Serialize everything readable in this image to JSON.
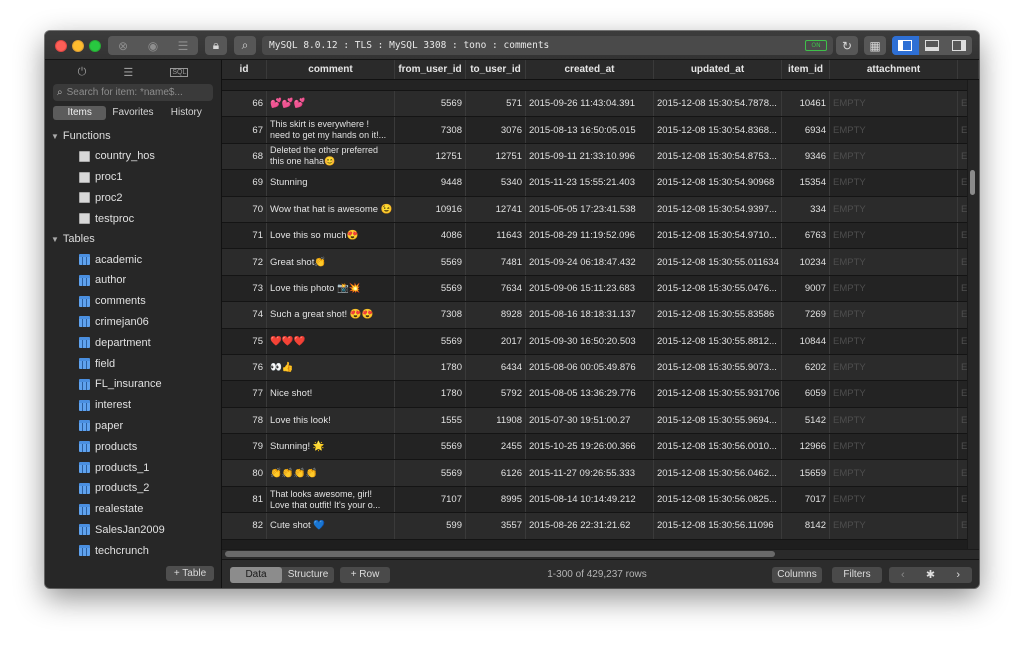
{
  "titlebar": {
    "connection": "MySQL 8.0.12 : TLS : MySQL 3308 : tono : comments",
    "connection_badge": "ON",
    "icons": [
      "close-tab-icon",
      "eye-icon",
      "list-icon",
      "lock-icon",
      "search-icon",
      "refresh-icon",
      "grid-icon",
      "left-panel-icon",
      "bottom-panel-icon",
      "right-panel-icon"
    ]
  },
  "sidebar": {
    "search_placeholder": "Search for item: *name$...",
    "tabs": [
      "Items",
      "Favorites",
      "History"
    ],
    "active_tab": "Items",
    "functions_label": "Functions",
    "functions": [
      "country_hos",
      "proc1",
      "proc2",
      "testproc"
    ],
    "tables_label": "Tables",
    "tables": [
      "academic",
      "author",
      "comments",
      "crimejan06",
      "department",
      "field",
      "FL_insurance",
      "interest",
      "paper",
      "products",
      "products_1",
      "products_2",
      "realestate",
      "SalesJan2009",
      "techcrunch"
    ],
    "add_table_label": "+ Table"
  },
  "grid": {
    "columns": [
      "id",
      "comment",
      "from_user_id",
      "to_user_id",
      "created_at",
      "updated_at",
      "item_id",
      "attachment"
    ],
    "rows": [
      {
        "id": "66",
        "comment": "💕💕💕",
        "from": "5569",
        "to": "571",
        "created": "2015-09-26 11:43:04.391",
        "updated": "2015-12-08 15:30:54.7878...",
        "item": "10461",
        "attach": "EMPTY"
      },
      {
        "id": "67",
        "comment": "This skirt is everywhere ! need to get my hands on it!...",
        "from": "7308",
        "to": "3076",
        "created": "2015-08-13 16:50:05.015",
        "updated": "2015-12-08 15:30:54.8368...",
        "item": "6934",
        "attach": "EMPTY"
      },
      {
        "id": "68",
        "comment": "Deleted the other preferred this one haha😊",
        "from": "12751",
        "to": "12751",
        "created": "2015-09-11 21:33:10.996",
        "updated": "2015-12-08 15:30:54.8753...",
        "item": "9346",
        "attach": "EMPTY"
      },
      {
        "id": "69",
        "comment": "Stunning",
        "from": "9448",
        "to": "5340",
        "created": "2015-11-23 15:55:21.403",
        "updated": "2015-12-08 15:30:54.90968",
        "item": "15354",
        "attach": "EMPTY"
      },
      {
        "id": "70",
        "comment": "Wow that hat is awesome 😉",
        "from": "10916",
        "to": "12741",
        "created": "2015-05-05 17:23:41.538",
        "updated": "2015-12-08 15:30:54.9397...",
        "item": "334",
        "attach": "EMPTY"
      },
      {
        "id": "71",
        "comment": " Love this so much😍",
        "from": "4086",
        "to": "11643",
        "created": "2015-08-29 11:19:52.096",
        "updated": "2015-12-08 15:30:54.9710...",
        "item": "6763",
        "attach": "EMPTY"
      },
      {
        "id": "72",
        "comment": "Great shot👏",
        "from": "5569",
        "to": "7481",
        "created": "2015-09-24 06:18:47.432",
        "updated": "2015-12-08 15:30:55.011634",
        "item": "10234",
        "attach": "EMPTY"
      },
      {
        "id": "73",
        "comment": "Love this photo 📸💥",
        "from": "5569",
        "to": "7634",
        "created": "2015-09-06 15:11:23.683",
        "updated": "2015-12-08 15:30:55.0476...",
        "item": "9007",
        "attach": "EMPTY"
      },
      {
        "id": "74",
        "comment": "Such a great shot! 😍😍",
        "from": "7308",
        "to": "8928",
        "created": "2015-08-16 18:18:31.137",
        "updated": "2015-12-08 15:30:55.83586",
        "item": "7269",
        "attach": "EMPTY"
      },
      {
        "id": "75",
        "comment": "❤️❤️❤️",
        "from": "5569",
        "to": "2017",
        "created": "2015-09-30 16:50:20.503",
        "updated": "2015-12-08 15:30:55.8812...",
        "item": "10844",
        "attach": "EMPTY"
      },
      {
        "id": "76",
        "comment": "👀👍",
        "from": "1780",
        "to": "6434",
        "created": "2015-08-06 00:05:49.876",
        "updated": "2015-12-08 15:30:55.9073...",
        "item": "6202",
        "attach": "EMPTY"
      },
      {
        "id": "77",
        "comment": "Nice shot!",
        "from": "1780",
        "to": "5792",
        "created": "2015-08-05 13:36:29.776",
        "updated": "2015-12-08 15:30:55.931706",
        "item": "6059",
        "attach": "EMPTY"
      },
      {
        "id": "78",
        "comment": "Love this look!",
        "from": "1555",
        "to": "11908",
        "created": "2015-07-30 19:51:00.27",
        "updated": "2015-12-08 15:30:55.9694...",
        "item": "5142",
        "attach": "EMPTY"
      },
      {
        "id": "79",
        "comment": "Stunning! 🌟",
        "from": "5569",
        "to": "2455",
        "created": "2015-10-25 19:26:00.366",
        "updated": "2015-12-08 15:30:56.0010...",
        "item": "12966",
        "attach": "EMPTY"
      },
      {
        "id": "80",
        "comment": "👏👏👏👏",
        "from": "5569",
        "to": "6126",
        "created": "2015-11-27 09:26:55.333",
        "updated": "2015-12-08 15:30:56.0462...",
        "item": "15659",
        "attach": "EMPTY"
      },
      {
        "id": "81",
        "comment": "That looks awesome, girl! Love that outfit! It's your o...",
        "from": "7107",
        "to": "8995",
        "created": "2015-08-14 10:14:49.212",
        "updated": "2015-12-08 15:30:56.0825...",
        "item": "7017",
        "attach": "EMPTY"
      },
      {
        "id": "82",
        "comment": "Cute shot 💙",
        "from": "599",
        "to": "3557",
        "created": "2015-08-26 22:31:21.62",
        "updated": "2015-12-08 15:30:56.11096",
        "item": "8142",
        "attach": "EMPTY"
      }
    ]
  },
  "bottombar": {
    "data_label": "Data",
    "structure_label": "Structure",
    "add_row_label": "+ Row",
    "row_count": "1-300 of 429,237 rows",
    "columns_label": "Columns",
    "filters_label": "Filters",
    "prev": "‹",
    "settings": "✱",
    "next": "›"
  }
}
